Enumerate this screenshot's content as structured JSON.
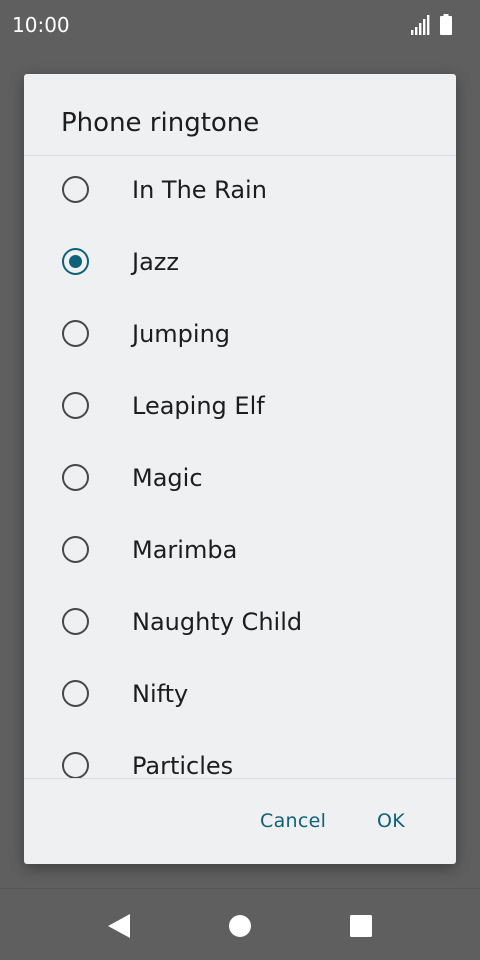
{
  "status_bar": {
    "time": "10:00",
    "icons": [
      "signal-icon",
      "battery-icon"
    ]
  },
  "dialog": {
    "title": "Phone ringtone",
    "options": [
      {
        "label": "In The Rain",
        "selected": false
      },
      {
        "label": "Jazz",
        "selected": true
      },
      {
        "label": "Jumping",
        "selected": false
      },
      {
        "label": "Leaping Elf",
        "selected": false
      },
      {
        "label": "Magic",
        "selected": false
      },
      {
        "label": "Marimba",
        "selected": false
      },
      {
        "label": "Naughty Child",
        "selected": false
      },
      {
        "label": "Nifty",
        "selected": false
      },
      {
        "label": "Particles",
        "selected": false
      }
    ],
    "cancel_label": "Cancel",
    "ok_label": "OK"
  },
  "nav_bar": {
    "icons": [
      "back-icon",
      "home-icon",
      "recents-icon"
    ]
  },
  "colors": {
    "accent": "#0f6179",
    "dialog_bg": "#eff0f2",
    "scrim": "#5f5f5f"
  }
}
